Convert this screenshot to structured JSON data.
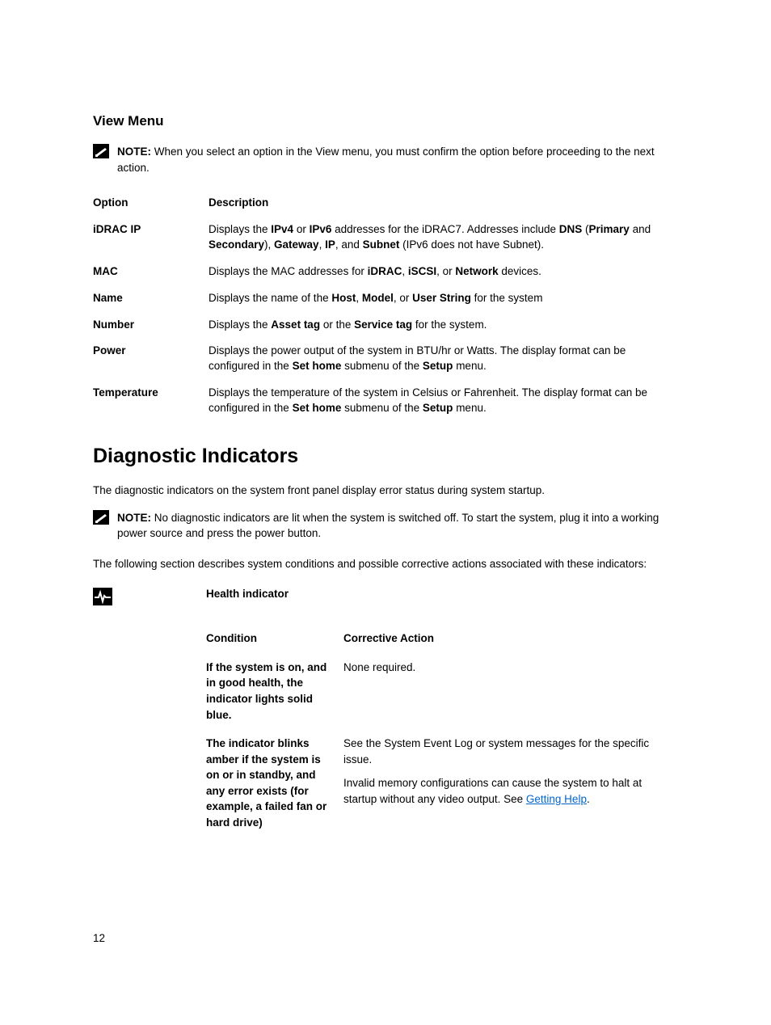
{
  "sectionTitle": "View Menu",
  "note1": {
    "label": "NOTE:",
    "text": " When you select an option in the View menu, you must confirm the option before proceeding to the next action."
  },
  "table": {
    "headers": {
      "option": "Option",
      "description": "Description"
    },
    "rows": [
      {
        "option": "iDRAC IP",
        "desc": {
          "segs": [
            {
              "t": "Displays the "
            },
            {
              "t": "IPv4",
              "b": true
            },
            {
              "t": " or "
            },
            {
              "t": "IPv6",
              "b": true
            },
            {
              "t": " addresses for the iDRAC7. Addresses include "
            },
            {
              "t": "DNS",
              "b": true
            },
            {
              "t": " ("
            },
            {
              "t": "Primary",
              "b": true
            },
            {
              "t": " and "
            },
            {
              "t": "Secondary",
              "b": true
            },
            {
              "t": "), "
            },
            {
              "t": "Gateway",
              "b": true
            },
            {
              "t": ", "
            },
            {
              "t": "IP",
              "b": true
            },
            {
              "t": ", and "
            },
            {
              "t": "Subnet",
              "b": true
            },
            {
              "t": " (IPv6 does not have Subnet)."
            }
          ]
        }
      },
      {
        "option": "MAC",
        "desc": {
          "segs": [
            {
              "t": "Displays the MAC addresses for "
            },
            {
              "t": "iDRAC",
              "b": true
            },
            {
              "t": ", "
            },
            {
              "t": "iSCSI",
              "b": true
            },
            {
              "t": ", or "
            },
            {
              "t": "Network",
              "b": true
            },
            {
              "t": " devices."
            }
          ]
        }
      },
      {
        "option": "Name",
        "desc": {
          "segs": [
            {
              "t": "Displays the name of the "
            },
            {
              "t": "Host",
              "b": true
            },
            {
              "t": ", "
            },
            {
              "t": "Model",
              "b": true
            },
            {
              "t": ", or "
            },
            {
              "t": "User String",
              "b": true
            },
            {
              "t": " for the system"
            }
          ]
        }
      },
      {
        "option": "Number",
        "desc": {
          "segs": [
            {
              "t": "Displays the "
            },
            {
              "t": "Asset tag",
              "b": true
            },
            {
              "t": " or the "
            },
            {
              "t": "Service tag",
              "b": true
            },
            {
              "t": " for the system."
            }
          ]
        }
      },
      {
        "option": "Power",
        "desc": {
          "segs": [
            {
              "t": "Displays the power output of the system in BTU/hr or Watts. The display format can be configured in the "
            },
            {
              "t": "Set home",
              "b": true
            },
            {
              "t": " submenu of the "
            },
            {
              "t": "Setup",
              "b": true
            },
            {
              "t": " menu."
            }
          ]
        }
      },
      {
        "option": "Temperature",
        "desc": {
          "segs": [
            {
              "t": "Displays the temperature of the system in Celsius or Fahrenheit. The display format can be configured in the "
            },
            {
              "t": "Set home",
              "b": true
            },
            {
              "t": " submenu of the "
            },
            {
              "t": "Setup",
              "b": true
            },
            {
              "t": " menu."
            }
          ]
        }
      }
    ]
  },
  "diagTitle": "Diagnostic Indicators",
  "diagIntro": "The diagnostic indicators on the system front panel display error status during system startup.",
  "note2": {
    "label": "NOTE:",
    "text": " No diagnostic indicators are lit when the system is switched off. To start the system, plug it into a working power source and press the power button."
  },
  "diagFollowing": "The following section describes system conditions and possible corrective actions associated with these indicators:",
  "healthTitle": "Health indicator",
  "condTable": {
    "headers": {
      "condition": "Condition",
      "action": "Corrective Action"
    },
    "rows": [
      {
        "condition": "If the system is on, and in good health, the indicator lights solid blue.",
        "actions": [
          {
            "segs": [
              {
                "t": "None required."
              }
            ]
          }
        ]
      },
      {
        "condition": "The indicator blinks amber if the system is on or in standby, and any error exists (for example, a failed fan or hard drive)",
        "actions": [
          {
            "segs": [
              {
                "t": "See the System Event Log or system messages for the specific issue."
              }
            ]
          },
          {
            "segs": [
              {
                "t": "Invalid memory configurations can cause the system to halt at startup without any video output. See "
              },
              {
                "t": "Getting Help",
                "link": true
              },
              {
                "t": "."
              }
            ]
          }
        ]
      }
    ]
  },
  "pageNumber": "12"
}
